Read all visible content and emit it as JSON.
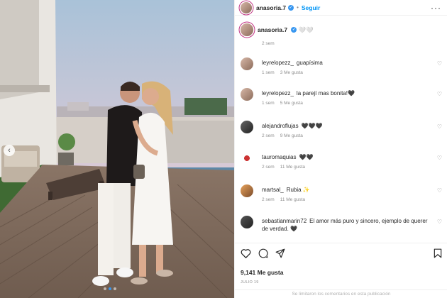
{
  "post": {
    "username": "anasoria.7",
    "follow_label": "Seguir",
    "separator": "•",
    "more_label": "···",
    "prev_arrow": "‹",
    "caption_emoji": "🤍🤍",
    "caption_time": "2 sem",
    "likes": "9,141 Me gusta",
    "date": "JULIO 19",
    "comments_limited": "Se limitaron los comentarios en esta publicación"
  },
  "comments": [
    {
      "user": "leyrelopezz_",
      "text": "guapísima",
      "time": "1 sem",
      "likes": "3 Me gusta"
    },
    {
      "user": "leyrelopezz_",
      "text": "la parejí mas bonita!🖤",
      "time": "1 sem",
      "likes": "5 Me gusta"
    },
    {
      "user": "alejandroflujas",
      "text": "🖤🖤🖤",
      "time": "2 sem",
      "likes": "9 Me gusta"
    },
    {
      "user": "tauromaquias",
      "text": "🖤🖤",
      "time": "2 sem",
      "likes": "11 Me gusta"
    },
    {
      "user": "martsal_",
      "text": "Rubia ✨",
      "time": "2 sem",
      "likes": "11 Me gusta"
    },
    {
      "user": "sebastianmarin72",
      "text": "El amor más puro y sincero, ejemplo de querer de verdad. 🖤",
      "time": "",
      "likes": ""
    }
  ],
  "icons": {
    "like": "heart-icon",
    "comment": "comment-icon",
    "share": "share-icon",
    "save": "bookmark-icon",
    "verified": "verified-badge-icon"
  },
  "colors": {
    "accent": "#0095f6",
    "text": "#262626",
    "muted": "#8e8e8e"
  }
}
